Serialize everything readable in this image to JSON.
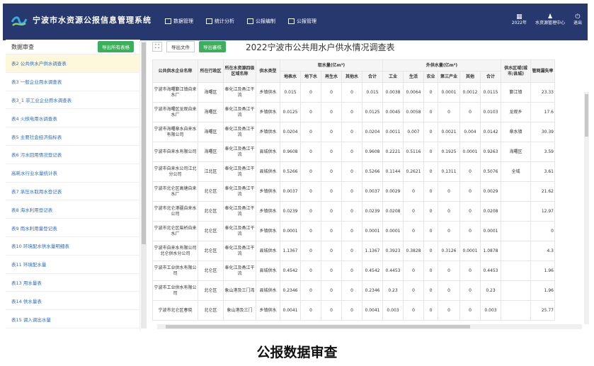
{
  "app": {
    "title": "宁波市水资源公报信息管理系统",
    "nav": [
      "数据管理",
      "统计分析",
      "公报编制",
      "公报管理"
    ],
    "tools": [
      {
        "icon": "calendar-icon",
        "label": "2022年"
      },
      {
        "icon": "user-icon",
        "label": "水资源管理中心"
      },
      {
        "icon": "power-icon",
        "label": "退出"
      }
    ]
  },
  "sidebar": {
    "title": "数据审查",
    "export_all": "导出所有表格",
    "items": [
      "表2 公共供水户供水调查表",
      "表3 一般企业用水调查表",
      "表3_1 非工业企业用水调查表",
      "表4 火核电用水调查表",
      "表5 主要社会经济指标表",
      "表6 污水回用情况登记表",
      "高耗水行业水量统计表",
      "表7 承压水取用水登记表",
      "表8 海水利用登记表",
      "表9 雨水利用量登记表",
      "表10 环境配水供水量明细表",
      "表11 环境配水量",
      "表13 用水量表",
      "表14 供水量表",
      "表15 调入调出水量"
    ]
  },
  "toolbar": {
    "export_file": "导出文件",
    "export_audit": "导出審核",
    "report_title": "2022宁波市公共用水户供水情况调查表"
  },
  "table": {
    "h_company": "公共供水企业名称",
    "h_district": "所在行政区",
    "h_basin": "所在水资源四级区域名称",
    "h_type": "供水类型",
    "h_intake": "取水量(亿m³)",
    "h_outside": "外供水量(亿m³)",
    "h_area": "供水区域(城市/县城)",
    "h_loss": "管网漏失率",
    "intake_cols": [
      "地表水",
      "地下水",
      "再生水",
      "其他水",
      "合计"
    ],
    "outside_cols": [
      "工业",
      "生活",
      "农业",
      "第三产业",
      "其他",
      "合计"
    ],
    "rows": [
      [
        "宁波市海曙鄞江镇自来水厂",
        "海曙区",
        "奉化江及甬江干流",
        "乡镇供水",
        "0.015",
        "0",
        "0",
        "0",
        "0.015",
        "0.0038",
        "0.0064",
        "0",
        "0.0001",
        "0.0012",
        "0.0115",
        "鄞江镇",
        "23.33"
      ],
      [
        "宁波市海曙区龙观自来水厂",
        "海曙区",
        "奉化江及甬江干流",
        "乡镇供水",
        "0.0125",
        "0",
        "0",
        "0",
        "0.0125",
        "0.0045",
        "0.0058",
        "0",
        "0",
        "0",
        "0.0103",
        "龙观乡",
        "17.6"
      ],
      [
        "宁波市海曙章水自来水有限公司",
        "海曙区",
        "奉化江及甬江干流",
        "乡镇供水",
        "0.0204",
        "0",
        "0",
        "0",
        "0.0204",
        "0.0011",
        "0.007",
        "0",
        "0.0021",
        "0.004",
        "0.0142",
        "章水镇",
        "30.39"
      ],
      [
        "宁波市自来水有限公司",
        "海曙区",
        "奉化江及甬江干流",
        "县城供水",
        "0.9608",
        "0",
        "0",
        "0",
        "0.9608",
        "0.2221",
        "0.5116",
        "0",
        "0.1925",
        "0.0001",
        "0.9263",
        "海曙区",
        "3.59"
      ],
      [
        "宁波市自来水公司江北分公司",
        "江北区",
        "奉化江及甬江干流",
        "县城供水",
        "0.5266",
        "0",
        "0",
        "0",
        "0.5266",
        "0.1144",
        "0.2621",
        "0",
        "0.1311",
        "0",
        "0.5076",
        "全域",
        "3.61"
      ],
      [
        "宁波市北仑区高塘自来水厂",
        "北仑区",
        "奉化江及甬江干流",
        "乡镇供水",
        "0.0037",
        "0",
        "0",
        "0",
        "0.0037",
        "0.0029",
        "0",
        "0",
        "0",
        "0",
        "0.0029",
        "",
        "21.62"
      ],
      [
        "宁波市北仑港疆自来水公司",
        "北仑区",
        "奉化江及甬江干流",
        "乡镇供水",
        "0.0239",
        "0",
        "0",
        "0",
        "0.0239",
        "0.0208",
        "0",
        "0",
        "0",
        "0",
        "0.0208",
        "",
        "12.97"
      ],
      [
        "宁波市北仑区柴桥自来水厂",
        "北仑区",
        "奉化江及甬江干流",
        "乡镇供水",
        "0.0001",
        "0",
        "0",
        "0",
        "0.0001",
        "0.0001",
        "0",
        "0",
        "0",
        "0",
        "0.0001",
        "",
        "0"
      ],
      [
        "宁波市自来水有限公司北仑供水分公司",
        "北仑区",
        "奉化江及甬江干流",
        "县城供水",
        "1.1367",
        "0",
        "0",
        "0",
        "1.1367",
        "0.3923",
        "0.3828",
        "0",
        "0.3126",
        "0.0001",
        "1.0878",
        "",
        "4.3"
      ],
      [
        "宁波市工业供水有限公司",
        "北仑区",
        "奉化江及甬江干流",
        "县城供水",
        "0.4542",
        "0",
        "0",
        "0",
        "0.4542",
        "0.4453",
        "0",
        "0",
        "0",
        "0",
        "0.4453",
        "",
        "1.96"
      ],
      [
        "宁波市工业供水有限公司",
        "北仑区",
        "象山港及三门湾",
        "县城供水",
        "0.2346",
        "0",
        "0",
        "0",
        "0.2346",
        "0.23",
        "0",
        "0",
        "0",
        "0",
        "0.23",
        "",
        "1.96"
      ],
      [
        "宁波市北仑区春晓",
        "北仑区",
        "象山港及三门",
        "乡镇供水",
        "0.0041",
        "0",
        "0",
        "0",
        "0.0041",
        "0.003",
        "0",
        "0",
        "0",
        "0",
        "0.003",
        "",
        "25.77"
      ]
    ]
  },
  "caption": "公报数据审查",
  "colors": {
    "topbar": "#27386e",
    "green": "#3dae5b",
    "link": "#2d6dc4",
    "active": "#fdf7db"
  }
}
